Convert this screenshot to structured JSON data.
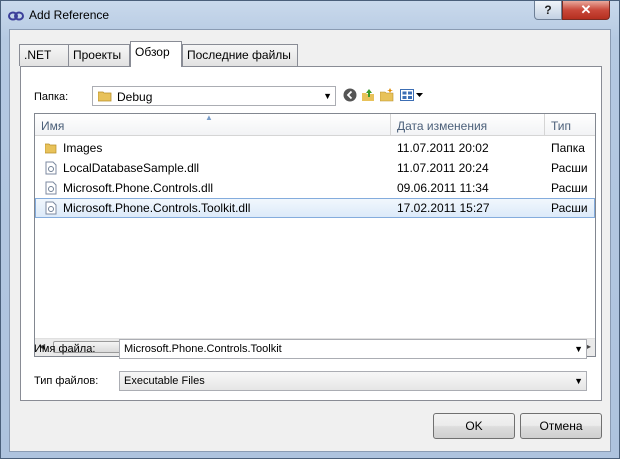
{
  "window": {
    "title": "Add Reference",
    "help_label": "?",
    "close_label": "✕"
  },
  "tabs": [
    {
      "label": ".NET",
      "active": false
    },
    {
      "label": "Проекты",
      "active": false
    },
    {
      "label": "Обзор",
      "active": true
    },
    {
      "label": "Последние файлы",
      "active": false
    }
  ],
  "folder": {
    "label": "Папка:",
    "value": "Debug"
  },
  "toolbar": {
    "icons": [
      "back-icon",
      "up-folder-icon",
      "new-folder-icon",
      "view-menu-icon"
    ]
  },
  "list": {
    "columns": [
      "Имя",
      "Дата изменения",
      "Тип"
    ],
    "rows": [
      {
        "name": "Images",
        "date": "11.07.2011 20:02",
        "type": "Папка",
        "icon": "folder-icon",
        "selected": false
      },
      {
        "name": "LocalDatabaseSample.dll",
        "date": "11.07.2011 20:24",
        "type": "Расши",
        "icon": "dll-file-icon",
        "selected": false
      },
      {
        "name": "Microsoft.Phone.Controls.dll",
        "date": "09.06.2011 11:34",
        "type": "Расши",
        "icon": "dll-file-icon",
        "selected": false
      },
      {
        "name": "Microsoft.Phone.Controls.Toolkit.dll",
        "date": "17.02.2011 15:27",
        "type": "Расши",
        "icon": "dll-file-icon",
        "selected": true
      }
    ]
  },
  "filename": {
    "label": "Имя файла:",
    "value": "Microsoft.Phone.Controls.Toolkit"
  },
  "filetype": {
    "label": "Тип файлов:",
    "value": "Executable Files"
  },
  "buttons": {
    "ok": "OK",
    "cancel": "Отмена"
  }
}
